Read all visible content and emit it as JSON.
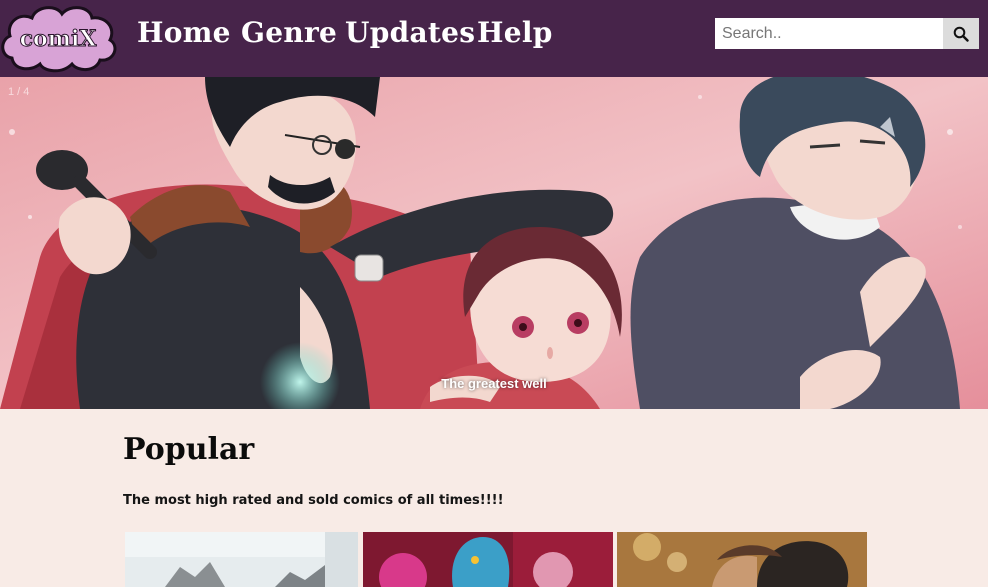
{
  "nav": {
    "logo_text": "comiX",
    "links": [
      "Home",
      "Genre",
      "Updates",
      "Help"
    ]
  },
  "search": {
    "placeholder": "Search..",
    "icon": "search-icon"
  },
  "hero": {
    "slide_counter": "1 / 4",
    "caption": "The greatest well"
  },
  "popular": {
    "title": "Popular",
    "subtitle": "The most high rated and sold comics of all times!!!!"
  },
  "colors": {
    "navbar": "#47244a",
    "page_background": "#f8ebe6",
    "logo_cloud": "#d9a0d6"
  }
}
